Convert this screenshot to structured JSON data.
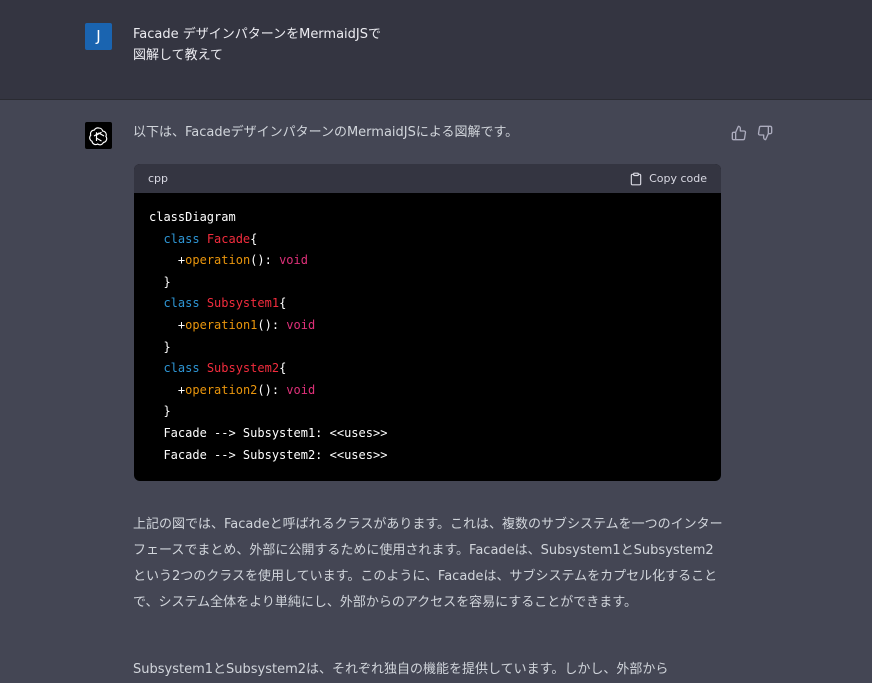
{
  "user": {
    "avatar_letter": "J",
    "message": "Facade デザインパターンをMermaidJSで\n図解して教えて"
  },
  "assistant": {
    "intro": "以下は、FacadeデザインパターンのMermaidJSによる図解です。",
    "code": {
      "language": "cpp",
      "copy_label": "Copy code",
      "line1": "classDiagram",
      "kw_class": "class",
      "facade": "Facade",
      "brace_open": "{",
      "brace_close": "}",
      "plus": "+",
      "operation": "operation",
      "operation1": "operation1",
      "operation2": "operation2",
      "paren_colon": "(): ",
      "void": "void",
      "subsystem1": "Subsystem1",
      "subsystem2": "Subsystem2",
      "rel1": "Facade --> Subsystem1: <<uses>>",
      "rel2": "Facade --> Subsystem2: <<uses>>"
    },
    "paragraph1": "上記の図では、Facadeと呼ばれるクラスがあります。これは、複数のサブシステムを一つのインターフェースでまとめ、外部に公開するために使用されます。Facadeは、Subsystem1とSubsystem2という2つのクラスを使用しています。このように、Facadeは、サブシステムをカプセル化することで、システム全体をより単純にし、外部からのアクセスを容易にすることができます。",
    "paragraph2": "Subsystem1とSubsystem2は、それぞれ独自の機能を提供しています。しかし、外部から"
  },
  "colors": {
    "user_bg": "#343541",
    "assistant_bg": "#444654",
    "avatar_user": "#1a64b0",
    "code_bg": "#000000",
    "keyword": "#2e95d3",
    "class_name": "#f22c3d"
  },
  "icons": [
    "openai-logo-icon",
    "thumbs-up-icon",
    "thumbs-down-icon",
    "clipboard-icon"
  ]
}
